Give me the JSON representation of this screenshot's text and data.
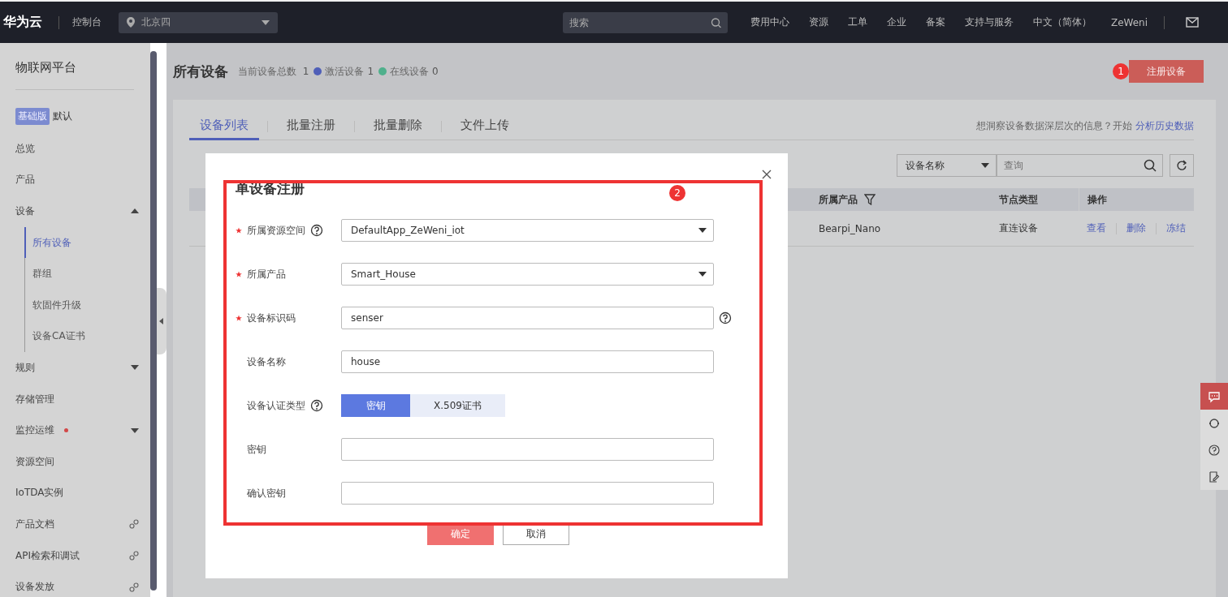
{
  "topbar": {
    "logo": "华为云",
    "console": "控制台",
    "region": "北京四",
    "search": {
      "placeholder": "搜索"
    },
    "nav": [
      "费用中心",
      "资源",
      "工单",
      "企业",
      "备案",
      "支持与服务",
      "中文（简体）"
    ],
    "user": "ZeWeni"
  },
  "sidebar": {
    "title": "物联网平台",
    "edition_badge": "基础版",
    "edition_label": "默认",
    "items": [
      {
        "label": "总览",
        "kind": "plain"
      },
      {
        "label": "产品",
        "kind": "plain"
      },
      {
        "label": "设备",
        "kind": "group",
        "expanded": true,
        "children": [
          {
            "label": "所有设备",
            "selected": true
          },
          {
            "label": "群组",
            "selected": false
          },
          {
            "label": "软固件升级",
            "selected": false
          },
          {
            "label": "设备CA证书",
            "selected": false
          }
        ]
      },
      {
        "label": "规则",
        "kind": "group",
        "expanded": false
      },
      {
        "label": "存储管理",
        "kind": "plain"
      },
      {
        "label": "监控运维",
        "kind": "group",
        "expanded": false,
        "alert": true
      },
      {
        "label": "资源空间",
        "kind": "plain"
      },
      {
        "label": "IoTDA实例",
        "kind": "plain"
      },
      {
        "label": "产品文档",
        "kind": "link"
      },
      {
        "label": "API检索和调试",
        "kind": "link"
      },
      {
        "label": "设备发放",
        "kind": "link"
      }
    ]
  },
  "page": {
    "title": "所有设备",
    "total_label": "当前设备总数",
    "total": "1",
    "legend": [
      {
        "label": "激活设备",
        "value": "1",
        "color": "#4f5fb8"
      },
      {
        "label": "在线设备",
        "value": "0",
        "color": "#4fb08c"
      }
    ],
    "register_button": "注册设备",
    "annotation_1": "1"
  },
  "tabs": [
    {
      "label": "设备列表",
      "selected": true
    },
    {
      "label": "批量注册",
      "selected": false
    },
    {
      "label": "批量删除",
      "selected": false
    },
    {
      "label": "文件上传",
      "selected": false
    }
  ],
  "insight": {
    "text": "想洞察设备数据深层次的信息？开始",
    "link": "分析历史数据"
  },
  "filter": {
    "field": "设备名称",
    "placeholder": "查询"
  },
  "table": {
    "columns": [
      "所属产品",
      "节点类型",
      "操作"
    ],
    "rows": [
      {
        "product": "Bearpi_Nano",
        "node_type": "直连设备",
        "actions": [
          "查看",
          "删除",
          "冻结"
        ]
      }
    ]
  },
  "dialog": {
    "title": "单设备注册",
    "annotation_2": "2",
    "fields": [
      {
        "label": "所属资源空间",
        "required": true,
        "help_after_label": true,
        "kind": "select",
        "value": "DefaultApp_ZeWeni_iot"
      },
      {
        "label": "所属产品",
        "required": true,
        "kind": "select",
        "value": "Smart_House"
      },
      {
        "label": "设备标识码",
        "required": true,
        "help_after_field": true,
        "kind": "input",
        "value": "senser"
      },
      {
        "label": "设备名称",
        "required": false,
        "kind": "input",
        "value": "house"
      },
      {
        "label": "设备认证类型",
        "required": false,
        "help_after_label": true,
        "kind": "toggle",
        "options": [
          {
            "label": "密钥",
            "selected": true
          },
          {
            "label": "X.509证书",
            "selected": false
          }
        ]
      },
      {
        "label": "密钥",
        "required": false,
        "kind": "input"
      },
      {
        "label": "确认密钥",
        "required": false,
        "kind": "input"
      }
    ],
    "confirm": "确定",
    "cancel": "取消"
  }
}
